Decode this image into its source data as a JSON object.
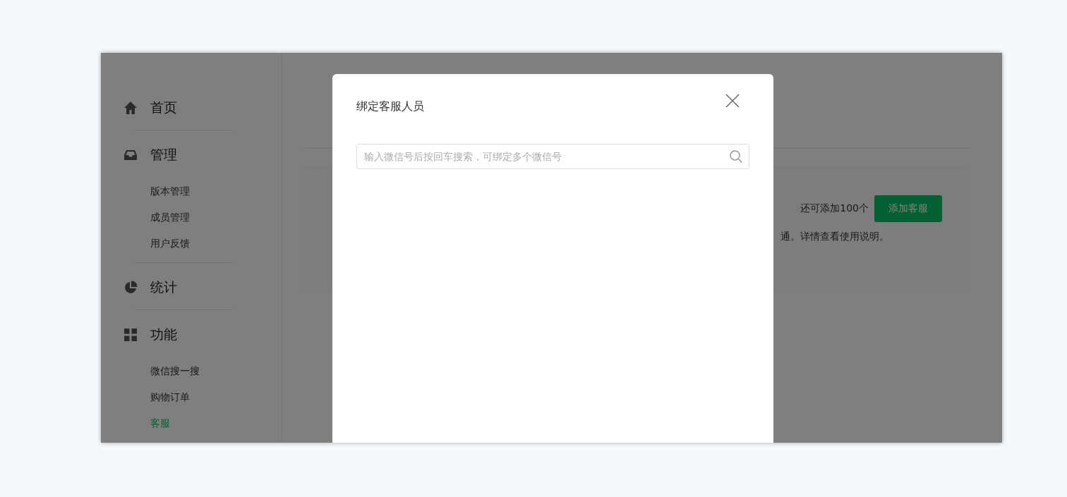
{
  "sidebar": {
    "groups": [
      {
        "kind": "home",
        "label": "首页"
      },
      {
        "kind": "inbox",
        "label": "管理",
        "items": [
          {
            "label": "版本管理",
            "selected": false
          },
          {
            "label": "成员管理",
            "selected": false
          },
          {
            "label": "用户反馈",
            "selected": false
          }
        ]
      },
      {
        "kind": "pie",
        "label": "统计"
      },
      {
        "kind": "grid",
        "label": "功能",
        "items": [
          {
            "label": "微信搜一搜",
            "selected": false
          },
          {
            "label": "购物订单",
            "selected": false
          },
          {
            "label": "客服",
            "selected": true
          }
        ]
      }
    ]
  },
  "main": {
    "quota_text": "还可添加100个",
    "add_button": "添加客服",
    "note": "通。详情查看使用说明。"
  },
  "dialog": {
    "title": "绑定客服人员",
    "search": {
      "placeholder": "输入微信号后按回车搜索，可绑定多个微信号"
    }
  }
}
